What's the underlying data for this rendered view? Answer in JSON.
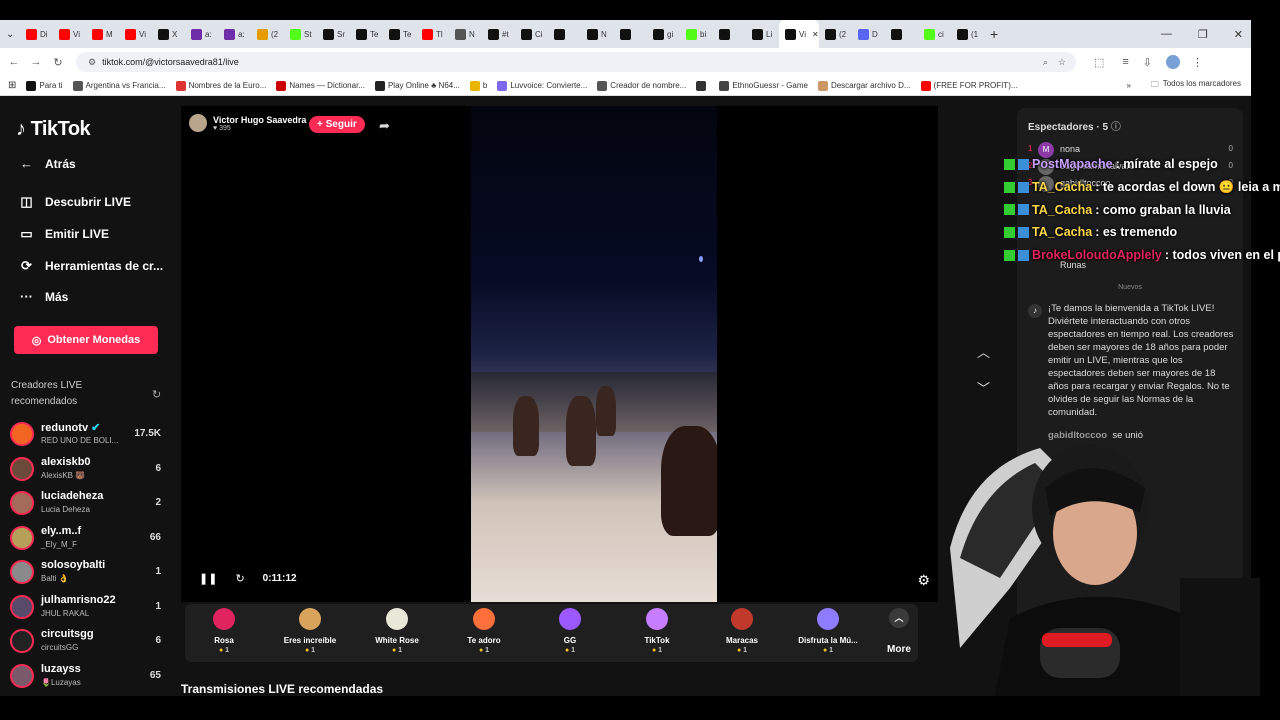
{
  "browser": {
    "tabs": [
      {
        "label": "Di",
        "color": "#ff0000"
      },
      {
        "label": "Vi",
        "color": "#ff0000"
      },
      {
        "label": "M",
        "color": "#ff0000"
      },
      {
        "label": "Vi",
        "color": "#ff0000"
      },
      {
        "label": "X",
        "color": "#111111"
      },
      {
        "label": "a:",
        "color": "#6f2da8"
      },
      {
        "label": "a:",
        "color": "#6f2da8"
      },
      {
        "label": "(2",
        "color": "#e69b00"
      },
      {
        "label": "St",
        "color": "#53fc18"
      },
      {
        "label": "Sr",
        "color": "#111111"
      },
      {
        "label": "Te",
        "color": "#111111"
      },
      {
        "label": "Te",
        "color": "#111111"
      },
      {
        "label": "Tl",
        "color": "#ff0000"
      },
      {
        "label": "N",
        "color": "#555555"
      },
      {
        "label": "#t",
        "color": "#111111"
      },
      {
        "label": "Ci",
        "color": "#111111"
      },
      {
        "label": "",
        "color": "#111111"
      },
      {
        "label": "N",
        "color": "#111111"
      },
      {
        "label": "",
        "color": "#111111"
      },
      {
        "label": "gi",
        "color": "#111111"
      },
      {
        "label": "bi",
        "color": "#53fc18"
      },
      {
        "label": "",
        "color": "#111111"
      },
      {
        "label": "Li",
        "color": "#111111"
      },
      {
        "label": "Vi",
        "color": "#111111",
        "active": true
      },
      {
        "label": "(2",
        "color": "#111111"
      },
      {
        "label": "D",
        "color": "#5865f2"
      },
      {
        "label": "",
        "color": "#111111"
      },
      {
        "label": "ci",
        "color": "#53fc18"
      },
      {
        "label": "(1",
        "color": "#111111"
      }
    ],
    "url": "tiktok.com/@victorsaavedra81/live",
    "bookmarks": [
      {
        "label": "Para ti",
        "color": "#111111"
      },
      {
        "label": "Argentina vs Francia...",
        "color": "#555555"
      },
      {
        "label": "Nombres de la Euro...",
        "color": "#d33"
      },
      {
        "label": "Names — Dictionar...",
        "color": "#c00"
      },
      {
        "label": "Play Online ♣ N64...",
        "color": "#222"
      },
      {
        "label": "b",
        "color": "#e8b500"
      },
      {
        "label": "Luvvoice: Convierte...",
        "color": "#7b68ee"
      },
      {
        "label": "Creador de nombre...",
        "color": "#555"
      },
      {
        "label": "",
        "color": "#333"
      },
      {
        "label": "EthnoGuessr - Game",
        "color": "#444"
      },
      {
        "label": "Descargar archivo D...",
        "color": "#c96"
      },
      {
        "label": "(FREE FOR PROFIT)...",
        "color": "#f00"
      }
    ],
    "all_bookmarks": "Todos los marcadores"
  },
  "sidebar": {
    "logo": "TikTok",
    "menu": [
      {
        "label": "Atrás",
        "icon": "back-arrow-icon"
      },
      {
        "label": "Descubrir LIVE",
        "icon": "compass-icon"
      },
      {
        "label": "Emitir LIVE",
        "icon": "camera-icon"
      },
      {
        "label": "Herramientas de cr...",
        "icon": "tools-icon"
      },
      {
        "label": "Más",
        "icon": "more-dots-icon"
      }
    ],
    "coins_button": "Obtener Monedas",
    "creators_heading": "Creadores LIVE recomendados",
    "creators": [
      {
        "name": "redunotv",
        "sub": "RED UNO DE BOLI...",
        "count": "17.5K",
        "verified": true,
        "color": "#f26522"
      },
      {
        "name": "alexiskb0",
        "sub": "AlexisKB 🐻",
        "count": "6",
        "color": "#6b4a3a"
      },
      {
        "name": "luciadeheza",
        "sub": "Lucia Deheza",
        "count": "2",
        "color": "#a56b5a"
      },
      {
        "name": "ely..m..f",
        "sub": "_Ely_M_F",
        "count": "66",
        "color": "#b5a05a"
      },
      {
        "name": "solosoybalti",
        "sub": "Balti 👌",
        "count": "1",
        "color": "#8a8a8a"
      },
      {
        "name": "julhamrisno22",
        "sub": "JHUL RAKAL",
        "count": "1",
        "color": "#5a4a6a"
      },
      {
        "name": "circuitsgg",
        "sub": "circuitsGG",
        "count": "6",
        "color": "#222222"
      },
      {
        "name": "luzayss",
        "sub": "🌷Luzayas",
        "count": "65",
        "color": "#7a5a6a"
      }
    ]
  },
  "stream": {
    "host_name": "Victor Hugo Saavedra",
    "likes": "♥ 395",
    "follow": "+ Seguir",
    "time": "0:11:12"
  },
  "gifts": [
    {
      "name": "Rosa",
      "price": "1",
      "color": "#e0245e"
    },
    {
      "name": "Eres increíble",
      "price": "1",
      "color": "#d9a35b"
    },
    {
      "name": "White Rose",
      "price": "1",
      "color": "#e8e8d8"
    },
    {
      "name": "Te adoro",
      "price": "1",
      "color": "#ff6f3c"
    },
    {
      "name": "GG",
      "price": "1",
      "color": "#9b59ff"
    },
    {
      "name": "TikTok",
      "price": "1",
      "color": "#c77dff"
    },
    {
      "name": "Maracas",
      "price": "1",
      "color": "#c0392b"
    },
    {
      "name": "Disfruta la Mú...",
      "price": "1",
      "color": "#8e7cff"
    }
  ],
  "more_label": "More",
  "recommended_title": "Transmisiones LIVE recomendadas",
  "viewers": {
    "title": "Espectadores · 5",
    "list": [
      {
        "rank": "1",
        "initial": "M",
        "name": "nona",
        "score": "0"
      },
      {
        "rank": "2",
        "initial": "",
        "name": "eugeniamartalvare",
        "score": "0"
      },
      {
        "rank": "3",
        "initial": "",
        "name": "gabidltoccoo",
        "score": "0"
      }
    ],
    "new_label": "Nuevos",
    "runas": "Runas",
    "welcome": "¡Te damos la bienvenida a TikTok LIVE! Diviértete interactuando con otros espectadores en tiempo real. Los creadores deben ser mayores de 18 años para poder emitir un LIVE, mientras que los espectadores deben ser mayores de 18 años para recargar y enviar Regalos. No te olvides de seguir las Normas de la comunidad.",
    "joined_user": "gabidltoccoo",
    "joined_text": "se unió"
  },
  "overlay_chat": [
    {
      "user": "PostMapache",
      "user_color": "#c9a0ff",
      "text": ": mírate al espejo"
    },
    {
      "user": "TA_Cacha",
      "user_color": "#ffd84d",
      "text": ": te acordas el down 😐 leia a m"
    },
    {
      "user": "TA_Cacha",
      "user_color": "#ffd84d",
      "text": ": como graban la lluvia"
    },
    {
      "user": "TA_Cacha",
      "user_color": "#ffd84d",
      "text": ": es tremendo"
    },
    {
      "user": "BrokeLoloudoApplely",
      "user_color": "#e0245e",
      "text": ": todos viven en el pu"
    }
  ]
}
